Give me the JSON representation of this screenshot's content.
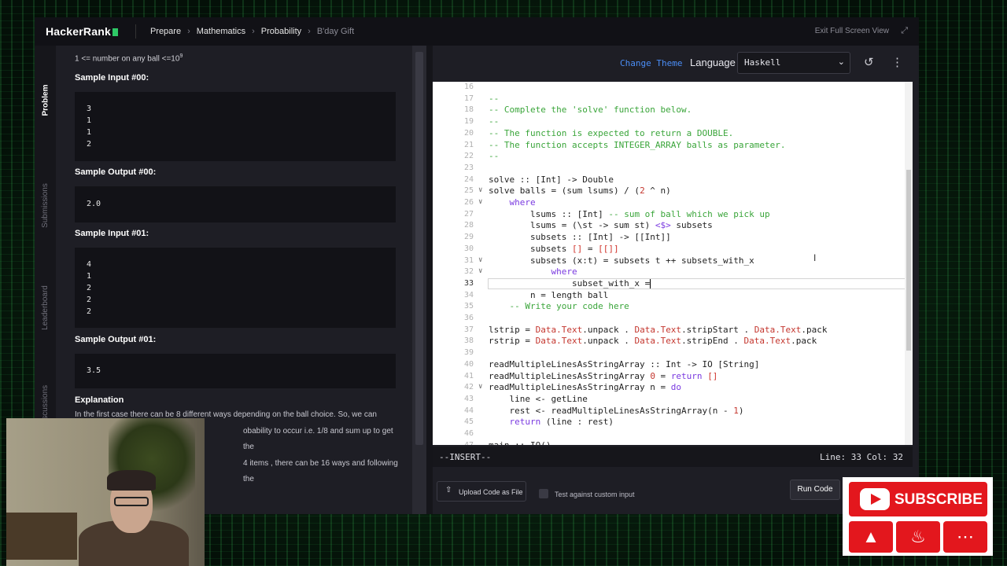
{
  "header": {
    "brand": "HackerRank",
    "breadcrumbs": [
      "Prepare",
      "Mathematics",
      "Probability",
      "B'day Gift"
    ],
    "exit_label": "Exit Full Screen View"
  },
  "side_tabs": [
    "Problem",
    "Submissions",
    "Leaderboard",
    "Discussions"
  ],
  "problem": {
    "constraint": "1 <= number on any ball <=10",
    "constraint_exp": "9",
    "sample_input_00_label": "Sample Input #00:",
    "sample_input_00": [
      "3",
      "1",
      "1",
      "2"
    ],
    "sample_output_00_label": "Sample Output #00:",
    "sample_output_00": "2.0",
    "sample_input_01_label": "Sample Input #01:",
    "sample_input_01": [
      "4",
      "1",
      "2",
      "2",
      "2"
    ],
    "sample_output_01_label": "Sample Output #01:",
    "sample_output_01": "3.5",
    "explanation_label": "Explanation",
    "explanation_lines": [
      "In the first case there can be 8 different ways depending on the ball choice. So, we can",
      "obability to occur i.e. 1/8 and sum up to get the",
      "4 items , there can be 16 ways and following the"
    ]
  },
  "editor": {
    "change_theme": "Change Theme",
    "language_label": "Language",
    "language_value": "Haskell",
    "mode": "--INSERT--",
    "position": "Line: 33 Col: 32",
    "current_line": 33,
    "lines": [
      {
        "n": "16",
        "text": ""
      },
      {
        "n": "17",
        "text": "--"
      },
      {
        "n": "18",
        "text": "-- Complete the 'solve' function below."
      },
      {
        "n": "19",
        "text": "--"
      },
      {
        "n": "20",
        "text": "-- The function is expected to return a DOUBLE."
      },
      {
        "n": "21",
        "text": "-- The function accepts INTEGER_ARRAY balls as parameter."
      },
      {
        "n": "22",
        "text": "--"
      },
      {
        "n": "23",
        "text": ""
      },
      {
        "n": "24",
        "text": "solve :: [Int] -> Double"
      },
      {
        "n": "25",
        "text": "solve balls = (sum lsums) / (2 ^ n)"
      },
      {
        "n": "26",
        "text": "    where"
      },
      {
        "n": "27",
        "text": "        lsums :: [Int] -- sum of ball which we pick up"
      },
      {
        "n": "28",
        "text": "        lsums = (\\st -> sum st) <$> subsets"
      },
      {
        "n": "29",
        "text": "        subsets :: [Int] -> [[Int]]"
      },
      {
        "n": "30",
        "text": "        subsets [] = [[]]"
      },
      {
        "n": "31",
        "text": "        subsets (x:t) = subsets t ++ subsets_with_x"
      },
      {
        "n": "32",
        "text": "            where"
      },
      {
        "n": "33",
        "text": "                subset_with_x ="
      },
      {
        "n": "34",
        "text": "        n = length ball"
      },
      {
        "n": "35",
        "text": "    -- Write your code here"
      },
      {
        "n": "36",
        "text": ""
      },
      {
        "n": "37",
        "text": "lstrip = Data.Text.unpack . Data.Text.stripStart . Data.Text.pack"
      },
      {
        "n": "38",
        "text": "rstrip = Data.Text.unpack . Data.Text.stripEnd . Data.Text.pack"
      },
      {
        "n": "39",
        "text": ""
      },
      {
        "n": "40",
        "text": "readMultipleLinesAsStringArray :: Int -> IO [String]"
      },
      {
        "n": "41",
        "text": "readMultipleLinesAsStringArray 0 = return []"
      },
      {
        "n": "42",
        "text": "readMultipleLinesAsStringArray n = do"
      },
      {
        "n": "43",
        "text": "    line <- getLine"
      },
      {
        "n": "44",
        "text": "    rest <- readMultipleLinesAsStringArray(n - 1)"
      },
      {
        "n": "45",
        "text": "    return (line : rest)"
      },
      {
        "n": "46",
        "text": ""
      },
      {
        "n": "47",
        "text": "main :: IO()"
      }
    ],
    "folds": [
      "25",
      "26",
      "31",
      "32",
      "42"
    ]
  },
  "footer": {
    "upload_label": "Upload Code as File",
    "custom_input_label": "Test against custom input",
    "run_label": "Run Code"
  },
  "overlay": {
    "subscribe_label": "SUBSCRIBE"
  },
  "colors": {
    "accent_green": "#2ec866",
    "link_blue": "#4b8ef7",
    "comment_green": "#3aa53a",
    "keyword_purple": "#7a3ae0",
    "youtube_red": "#e3171d"
  }
}
